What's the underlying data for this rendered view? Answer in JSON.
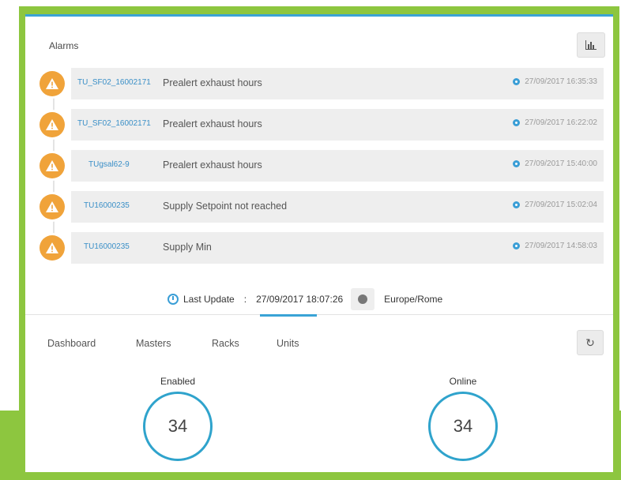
{
  "alarms": {
    "title": "Alarms",
    "chart_icon": "bar-chart-icon",
    "items": [
      {
        "unit": "TU_SF02_16002171",
        "message": "Prealert exhaust hours",
        "time": "27/09/2017 16:35:33"
      },
      {
        "unit": "TU_SF02_16002171",
        "message": "Prealert exhaust hours",
        "time": "27/09/2017 16:22:02"
      },
      {
        "unit": "TUgsal62-9",
        "message": "Prealert exhaust hours",
        "time": "27/09/2017 15:40:00"
      },
      {
        "unit": "TU16000235",
        "message": "Supply Setpoint not reached",
        "time": "27/09/2017 15:02:04"
      },
      {
        "unit": "TU16000235",
        "message": "Supply Min",
        "time": "27/09/2017 14:58:03"
      }
    ],
    "warning_color": "#f0a33a"
  },
  "status": {
    "last_update_label": "Last Update",
    "separator": ":",
    "last_update_value": "27/09/2017 18:07:26",
    "timezone": "Europe/Rome"
  },
  "tabs": {
    "items": [
      "Dashboard",
      "Masters",
      "Racks",
      "Units"
    ],
    "active": "Units",
    "refresh_icon": "refresh-icon"
  },
  "stats": {
    "enabled_label": "Enabled",
    "enabled_value": "34",
    "online_label": "Online",
    "online_value": "34"
  },
  "colors": {
    "frame": "#8dc63f",
    "accent": "#3aa3d6",
    "circle": "#2fa3cc"
  }
}
